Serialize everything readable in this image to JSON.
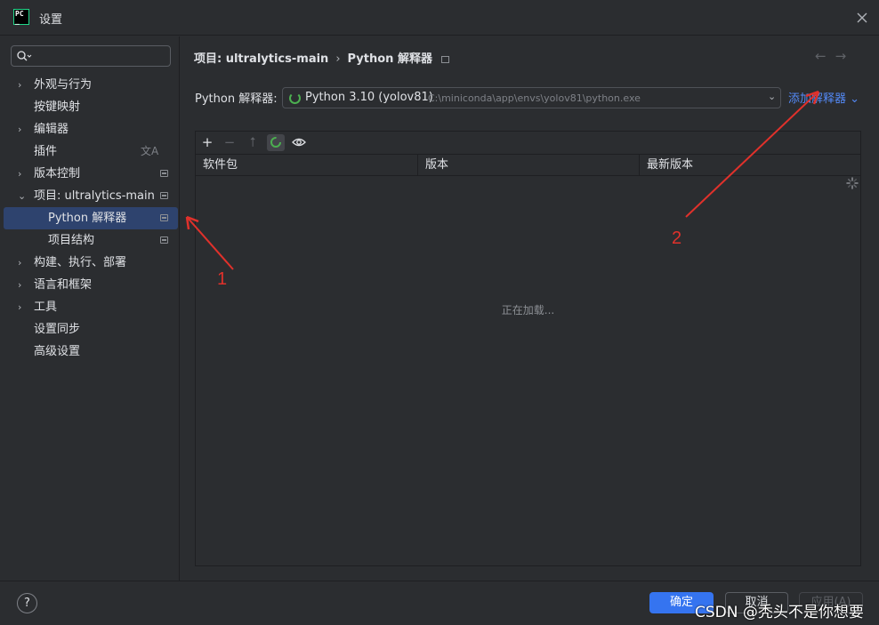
{
  "window": {
    "title": "设置",
    "logo_text": [
      "PC",
      "_"
    ]
  },
  "sidebar": {
    "search_placeholder": "",
    "items": [
      {
        "label": "外观与行为",
        "chevron": "›",
        "expandable": true
      },
      {
        "label": "按键映射"
      },
      {
        "label": "编辑器",
        "chevron": "›",
        "expandable": true
      },
      {
        "label": "插件",
        "translate_glyph": "文A"
      },
      {
        "label": "版本控制",
        "chevron": "›",
        "expandable": true
      },
      {
        "label": "项目: ultralytics-main",
        "chevron": "⌄",
        "expanded": true
      },
      {
        "label": "Python 解释器",
        "selected": true
      },
      {
        "label": "项目结构"
      },
      {
        "label": "构建、执行、部署",
        "chevron": "›",
        "expandable": true
      },
      {
        "label": "语言和框架",
        "chevron": "›",
        "expandable": true
      },
      {
        "label": "工具",
        "chevron": "›",
        "expandable": true
      },
      {
        "label": "设置同步"
      },
      {
        "label": "高级设置"
      }
    ]
  },
  "main": {
    "breadcrumb": {
      "project": "项目: ultralytics-main",
      "separator": "›",
      "page": "Python 解释器"
    },
    "nav_back": "←",
    "nav_forward": "→",
    "interpreter_label": "Python 解释器:",
    "interpreter_name": "Python 3.10 (yolov81)",
    "interpreter_path": "C:\\miniconda\\app\\envs\\yolov81\\python.exe",
    "dropdown_glyph": "⌄",
    "add_interpreter": "添加解释器 ⌄",
    "toolbar": {
      "add": "+",
      "remove": "−",
      "upgrade": "⭡"
    },
    "columns": [
      "软件包",
      "版本",
      "最新版本"
    ],
    "loading_text": "正在加载..."
  },
  "footer": {
    "help": "?",
    "ok": "确定",
    "cancel": "取消",
    "apply": "应用(A)",
    "watermark": "CSDN @秃头不是你想要"
  },
  "annotations": {
    "label_1": "1",
    "label_2": "2",
    "color": "#e0312b"
  },
  "colors": {
    "accent": "#3574f0",
    "link": "#548af7",
    "selected_bg": "#2e436e",
    "background": "#2b2d30"
  }
}
